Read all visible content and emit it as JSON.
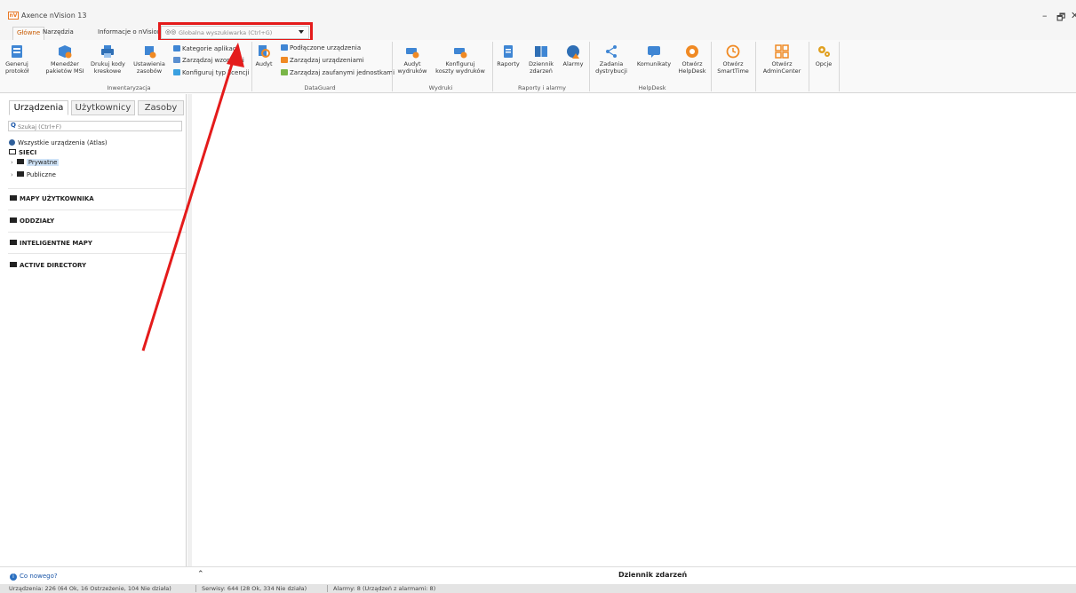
{
  "app": {
    "logo_text": "nV",
    "title": "Axence nVision 13",
    "window_controls": {
      "minimize": "–",
      "maximize": "🗗",
      "close": "✕"
    }
  },
  "ribbon_tabs": [
    {
      "label": "Główne",
      "active": true
    },
    {
      "label": "Narzędzia",
      "active": false
    },
    {
      "label": "Informacje o nVision",
      "active": false
    }
  ],
  "global_search": {
    "icon": "binoculars-icon",
    "placeholder": "Globalna wyszukiwarka (Ctrl+G)"
  },
  "ribbon": {
    "buttons": [
      {
        "label": "Generuj\nprotokół",
        "icon": "report-icon"
      },
      {
        "label": "Menedżer\npakietów MSI",
        "icon": "package-icon"
      },
      {
        "label": "Drukuj kody\nkreskowe",
        "icon": "printer-icon"
      },
      {
        "label": "Ustawienia\nzasobów",
        "icon": "assets-settings-icon"
      },
      {
        "label": "Audyt",
        "icon": "audit-icon"
      },
      {
        "label": "Audyt\nwydruków",
        "icon": "print-audit-icon"
      },
      {
        "label": "Konfiguruj\nkoszty wydruków",
        "icon": "print-cost-icon"
      },
      {
        "label": "Raporty",
        "icon": "clipboard-icon"
      },
      {
        "label": "Dziennik\nzdarzeń",
        "icon": "book-icon"
      },
      {
        "label": "Alarmy",
        "icon": "alarm-icon"
      },
      {
        "label": "Zadania\ndystrybucji",
        "icon": "distribution-icon"
      },
      {
        "label": "Komunikaty",
        "icon": "message-icon"
      },
      {
        "label": "Otwórz\nHelpDesk",
        "icon": "lifebuoy-icon"
      },
      {
        "label": "Otwórz\nSmartTime",
        "icon": "smarttime-icon"
      },
      {
        "label": "Otwórz\nAdminCenter",
        "icon": "admincenter-icon"
      },
      {
        "label": "Opcje",
        "icon": "gears-icon"
      }
    ],
    "small_buttons_inw": [
      "Kategorie aplikacji",
      "Zarządzaj wzorcami",
      "Konfiguruj typ licencji"
    ],
    "small_buttons_dg": [
      "Podłączone urządzenia",
      "Zarządzaj urządzeniami",
      "Zarządzaj zaufanymi jednostkami"
    ],
    "groups": [
      "Inwentaryzacja",
      "DataGuard",
      "Wydruki",
      "Raporty i alarmy",
      "HelpDesk"
    ]
  },
  "sidebar": {
    "tabs": [
      {
        "label": "Urządzenia",
        "active": true
      },
      {
        "label": "Użytkownicy",
        "active": false
      },
      {
        "label": "Zasoby",
        "active": false
      }
    ],
    "search_placeholder": "Szukaj (Ctrl+F)",
    "tree": {
      "all_devices": "Wszystkie urządzenia (Atlas)",
      "networks": "SIECI",
      "private": "Prywatne",
      "public": "Publiczne"
    },
    "sections": [
      "MAPY UŻYTKOWNIKA",
      "ODDZIAŁY",
      "INTELIGENTNE MAPY",
      "ACTIVE DIRECTORY"
    ]
  },
  "bottom": {
    "whats_new": "Co nowego?",
    "expand_glyph": "⌃",
    "event_log": "Dziennik zdarzeń"
  },
  "status": {
    "devices": "Urządzenia: 226 (64 Ok, 16 Ostrzeżenie, 104 Nie działa)",
    "services": "Serwisy: 644 (28 Ok, 334 Nie działa)",
    "alarms": "Alarmy: 8 (Urządzeń z alarmami: 8)"
  },
  "colors": {
    "accent_orange": "#c85a00",
    "highlight_red": "#e41b1b",
    "link_blue": "#1a56a8"
  }
}
